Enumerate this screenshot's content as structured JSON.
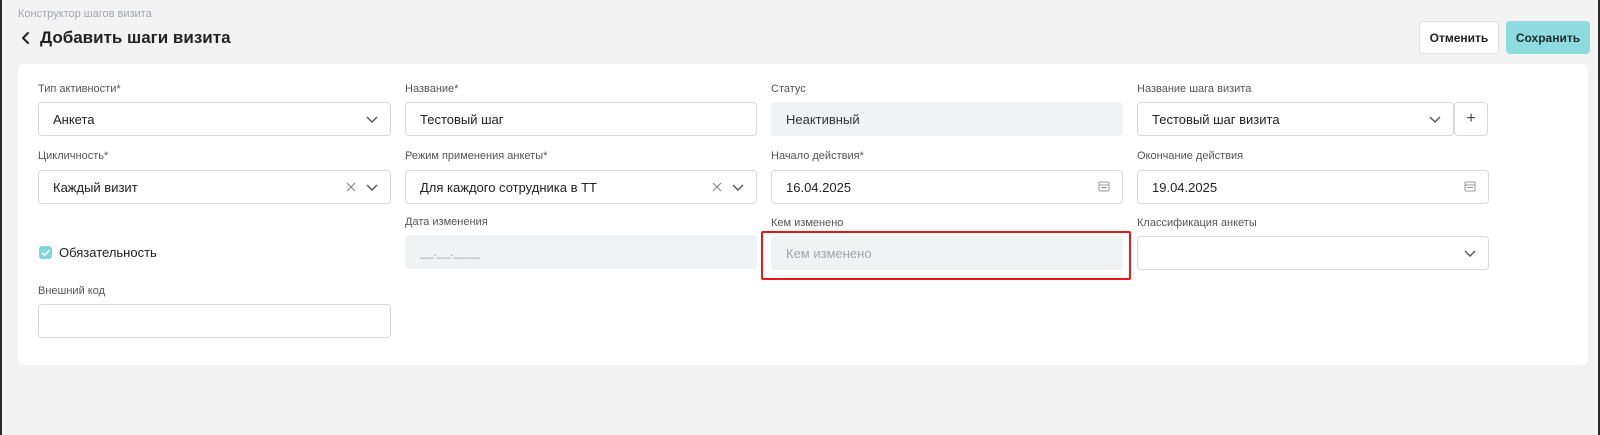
{
  "breadcrumb": "Конструктор шагов визита",
  "page": {
    "title": "Добавить шаги визита"
  },
  "toolbar": {
    "cancel_label": "Отменить",
    "save_label": "Сохранить"
  },
  "colors": {
    "accent": "#8fdce0",
    "highlight": "#e51919"
  },
  "form": {
    "activity_type": {
      "label": "Тип активности*",
      "value": "Анкета"
    },
    "name": {
      "label": "Название*",
      "value": "Тестовый шаг"
    },
    "status": {
      "label": "Статус",
      "value": "Неактивный"
    },
    "step_name": {
      "label": "Название шага визита",
      "value": "Тестовый шаг визита",
      "add_label": "+"
    },
    "cyclicity": {
      "label": "Цикличность*",
      "value": "Каждый визит"
    },
    "apply_mode": {
      "label": "Режим применения анкеты*",
      "value": "Для каждого сотрудника в ТТ"
    },
    "start_date": {
      "label": "Начало действия*",
      "value": "16.04.2025"
    },
    "end_date": {
      "label": "Окончание действия",
      "value": "19.04.2025"
    },
    "required": {
      "label": "Обязательность",
      "checked": true
    },
    "changed_date": {
      "label": "Дата изменения",
      "value": "__.__.____"
    },
    "changed_by": {
      "label": "Кем изменено",
      "placeholder": "Кем изменено"
    },
    "classification": {
      "label": "Классификация анкеты",
      "value": ""
    },
    "external_code": {
      "label": "Внешний код",
      "value": ""
    }
  }
}
